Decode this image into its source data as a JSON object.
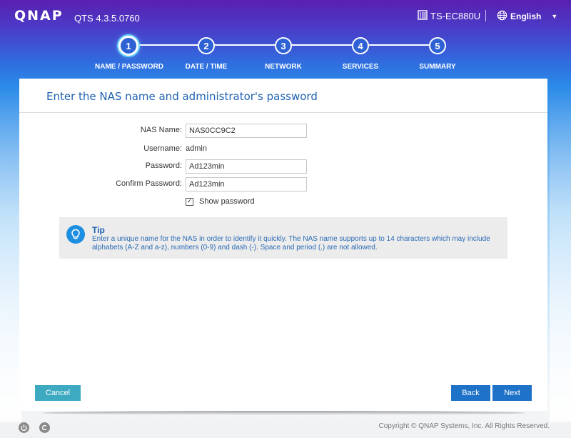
{
  "header": {
    "logo": "QNAP",
    "version": "QTS 4.3.5.0760",
    "model": "TS-EC880U",
    "language": "English"
  },
  "steps": [
    {
      "number": "1",
      "label": "NAME / PASSWORD",
      "active": true
    },
    {
      "number": "2",
      "label": "DATE / TIME",
      "active": false
    },
    {
      "number": "3",
      "label": "NETWORK",
      "active": false
    },
    {
      "number": "4",
      "label": "SERVICES",
      "active": false
    },
    {
      "number": "5",
      "label": "SUMMARY",
      "active": false
    }
  ],
  "panel": {
    "heading": "Enter the NAS name and administrator's password"
  },
  "form": {
    "nas_name_label": "NAS Name:",
    "nas_name_value": "NAS0CC9C2",
    "username_label": "Username:",
    "username_value": "admin",
    "password_label": "Password:",
    "password_value": "Ad123min",
    "confirm_label": "Confirm Password:",
    "confirm_value": "Ad123min",
    "show_password_label": "Show password",
    "show_password_checked": true
  },
  "tip": {
    "title": "Tip",
    "text": "Enter a unique name for the NAS in order to identify it quickly. The NAS name supports up to 14 characters which may include alphabets (A-Z and a-z), numbers (0-9) and dash (-). Space and period (.) are not allowed."
  },
  "buttons": {
    "cancel": "Cancel",
    "back": "Back",
    "next": "Next"
  },
  "footer": {
    "copyright": "Copyright © QNAP Systems, Inc. All Rights Reserved."
  },
  "colors": {
    "accent": "#1f62b2",
    "button_primary": "#1e72c8",
    "button_cancel": "#3eaac2"
  }
}
